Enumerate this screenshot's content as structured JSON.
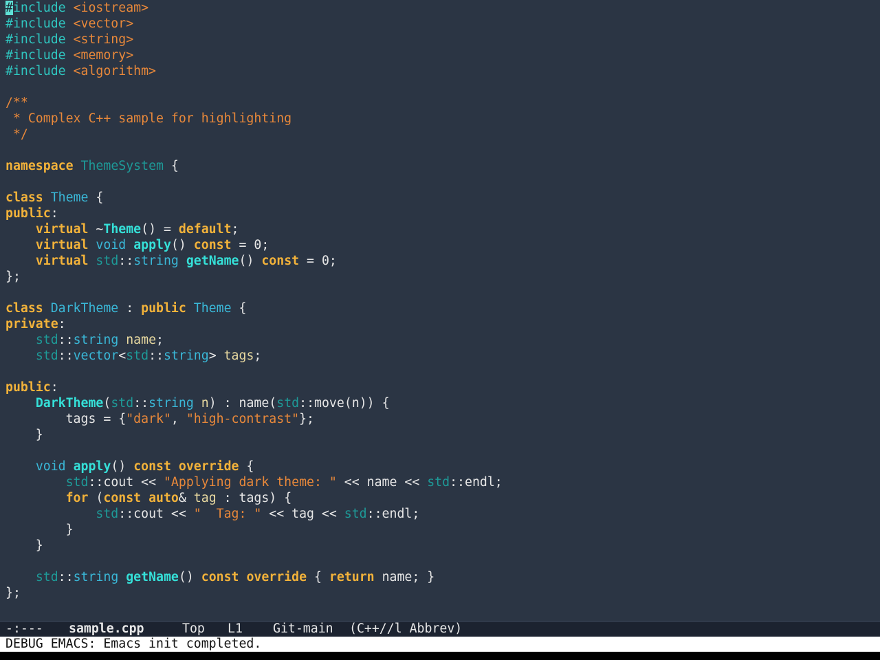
{
  "colors": {
    "background": "#2b3544",
    "text": "#e6e6e6",
    "preprocessor": "#2fc6c0",
    "include_path": "#e8883a",
    "comment": "#e8883a",
    "keyword": "#f2b23a",
    "type": "#3ab8d8",
    "function": "#35e0d8",
    "namespace_std": "#1e9a98",
    "string": "#e8883a",
    "variable": "#e8d9a0",
    "cursor": "#5fe0d6",
    "modeline_bg": "#1c2330",
    "echo_bg": "#ffffff"
  },
  "editor": {
    "cursor_char": "#",
    "lines": [
      [
        {
          "t": "include",
          "c": "preprocessor"
        },
        {
          "t": " ",
          "c": "text"
        },
        {
          "t": "<iostream>",
          "c": "include_path"
        }
      ],
      [
        {
          "t": "#include",
          "c": "preprocessor"
        },
        {
          "t": " ",
          "c": "text"
        },
        {
          "t": "<vector>",
          "c": "include_path"
        }
      ],
      [
        {
          "t": "#include",
          "c": "preprocessor"
        },
        {
          "t": " ",
          "c": "text"
        },
        {
          "t": "<string>",
          "c": "include_path"
        }
      ],
      [
        {
          "t": "#include",
          "c": "preprocessor"
        },
        {
          "t": " ",
          "c": "text"
        },
        {
          "t": "<memory>",
          "c": "include_path"
        }
      ],
      [
        {
          "t": "#include",
          "c": "preprocessor"
        },
        {
          "t": " ",
          "c": "text"
        },
        {
          "t": "<algorithm>",
          "c": "include_path"
        }
      ],
      [],
      [
        {
          "t": "/**",
          "c": "comment"
        }
      ],
      [
        {
          "t": " * Complex C++ sample for highlighting",
          "c": "comment"
        }
      ],
      [
        {
          "t": " */",
          "c": "comment"
        }
      ],
      [],
      [
        {
          "t": "namespace",
          "c": "keyword",
          "b": true
        },
        {
          "t": " ",
          "c": "text"
        },
        {
          "t": "ThemeSystem",
          "c": "namespace_std"
        },
        {
          "t": " {",
          "c": "text"
        }
      ],
      [],
      [
        {
          "t": "class",
          "c": "keyword",
          "b": true
        },
        {
          "t": " ",
          "c": "text"
        },
        {
          "t": "Theme",
          "c": "type"
        },
        {
          "t": " {",
          "c": "text"
        }
      ],
      [
        {
          "t": "public",
          "c": "keyword",
          "b": true
        },
        {
          "t": ":",
          "c": "text"
        }
      ],
      [
        {
          "t": "    ",
          "c": "text"
        },
        {
          "t": "virtual",
          "c": "keyword",
          "b": true
        },
        {
          "t": " ~",
          "c": "text"
        },
        {
          "t": "Theme",
          "c": "function",
          "b": true
        },
        {
          "t": "() = ",
          "c": "text"
        },
        {
          "t": "default",
          "c": "keyword",
          "b": true
        },
        {
          "t": ";",
          "c": "text"
        }
      ],
      [
        {
          "t": "    ",
          "c": "text"
        },
        {
          "t": "virtual",
          "c": "keyword",
          "b": true
        },
        {
          "t": " ",
          "c": "text"
        },
        {
          "t": "void",
          "c": "type"
        },
        {
          "t": " ",
          "c": "text"
        },
        {
          "t": "apply",
          "c": "function",
          "b": true
        },
        {
          "t": "() ",
          "c": "text"
        },
        {
          "t": "const",
          "c": "keyword",
          "b": true
        },
        {
          "t": " = 0;",
          "c": "text"
        }
      ],
      [
        {
          "t": "    ",
          "c": "text"
        },
        {
          "t": "virtual",
          "c": "keyword",
          "b": true
        },
        {
          "t": " ",
          "c": "text"
        },
        {
          "t": "std",
          "c": "namespace_std"
        },
        {
          "t": "::",
          "c": "text"
        },
        {
          "t": "string",
          "c": "type"
        },
        {
          "t": " ",
          "c": "text"
        },
        {
          "t": "getName",
          "c": "function",
          "b": true
        },
        {
          "t": "() ",
          "c": "text"
        },
        {
          "t": "const",
          "c": "keyword",
          "b": true
        },
        {
          "t": " = 0;",
          "c": "text"
        }
      ],
      [
        {
          "t": "};",
          "c": "text"
        }
      ],
      [],
      [
        {
          "t": "class",
          "c": "keyword",
          "b": true
        },
        {
          "t": " ",
          "c": "text"
        },
        {
          "t": "DarkTheme",
          "c": "type"
        },
        {
          "t": " : ",
          "c": "text"
        },
        {
          "t": "public",
          "c": "keyword",
          "b": true
        },
        {
          "t": " ",
          "c": "text"
        },
        {
          "t": "Theme",
          "c": "type"
        },
        {
          "t": " {",
          "c": "text"
        }
      ],
      [
        {
          "t": "private",
          "c": "keyword",
          "b": true
        },
        {
          "t": ":",
          "c": "text"
        }
      ],
      [
        {
          "t": "    ",
          "c": "text"
        },
        {
          "t": "std",
          "c": "namespace_std"
        },
        {
          "t": "::",
          "c": "text"
        },
        {
          "t": "string",
          "c": "type"
        },
        {
          "t": " ",
          "c": "text"
        },
        {
          "t": "name",
          "c": "variable"
        },
        {
          "t": ";",
          "c": "text"
        }
      ],
      [
        {
          "t": "    ",
          "c": "text"
        },
        {
          "t": "std",
          "c": "namespace_std"
        },
        {
          "t": "::",
          "c": "text"
        },
        {
          "t": "vector",
          "c": "type"
        },
        {
          "t": "<",
          "c": "text"
        },
        {
          "t": "std",
          "c": "namespace_std"
        },
        {
          "t": "::",
          "c": "text"
        },
        {
          "t": "string",
          "c": "type"
        },
        {
          "t": "> ",
          "c": "text"
        },
        {
          "t": "tags",
          "c": "variable"
        },
        {
          "t": ";",
          "c": "text"
        }
      ],
      [],
      [
        {
          "t": "public",
          "c": "keyword",
          "b": true
        },
        {
          "t": ":",
          "c": "text"
        }
      ],
      [
        {
          "t": "    ",
          "c": "text"
        },
        {
          "t": "DarkTheme",
          "c": "function",
          "b": true
        },
        {
          "t": "(",
          "c": "text"
        },
        {
          "t": "std",
          "c": "namespace_std"
        },
        {
          "t": "::",
          "c": "text"
        },
        {
          "t": "string",
          "c": "type"
        },
        {
          "t": " ",
          "c": "text"
        },
        {
          "t": "n",
          "c": "variable"
        },
        {
          "t": ") : name(",
          "c": "text"
        },
        {
          "t": "std",
          "c": "namespace_std"
        },
        {
          "t": "::move(n)) {",
          "c": "text"
        }
      ],
      [
        {
          "t": "        tags = {",
          "c": "text"
        },
        {
          "t": "\"dark\"",
          "c": "string"
        },
        {
          "t": ", ",
          "c": "text"
        },
        {
          "t": "\"high-contrast\"",
          "c": "string"
        },
        {
          "t": "};",
          "c": "text"
        }
      ],
      [
        {
          "t": "    }",
          "c": "text"
        }
      ],
      [],
      [
        {
          "t": "    ",
          "c": "text"
        },
        {
          "t": "void",
          "c": "type"
        },
        {
          "t": " ",
          "c": "text"
        },
        {
          "t": "apply",
          "c": "function",
          "b": true
        },
        {
          "t": "() ",
          "c": "text"
        },
        {
          "t": "const",
          "c": "keyword",
          "b": true
        },
        {
          "t": " ",
          "c": "text"
        },
        {
          "t": "override",
          "c": "keyword",
          "b": true
        },
        {
          "t": " {",
          "c": "text"
        }
      ],
      [
        {
          "t": "        ",
          "c": "text"
        },
        {
          "t": "std",
          "c": "namespace_std"
        },
        {
          "t": "::cout << ",
          "c": "text"
        },
        {
          "t": "\"Applying dark theme: \"",
          "c": "string"
        },
        {
          "t": " << name << ",
          "c": "text"
        },
        {
          "t": "std",
          "c": "namespace_std"
        },
        {
          "t": "::endl;",
          "c": "text"
        }
      ],
      [
        {
          "t": "        ",
          "c": "text"
        },
        {
          "t": "for",
          "c": "keyword",
          "b": true
        },
        {
          "t": " (",
          "c": "text"
        },
        {
          "t": "const",
          "c": "keyword",
          "b": true
        },
        {
          "t": " ",
          "c": "text"
        },
        {
          "t": "auto",
          "c": "keyword",
          "b": true
        },
        {
          "t": "& ",
          "c": "text"
        },
        {
          "t": "tag",
          "c": "variable"
        },
        {
          "t": " : tags) {",
          "c": "text"
        }
      ],
      [
        {
          "t": "            ",
          "c": "text"
        },
        {
          "t": "std",
          "c": "namespace_std"
        },
        {
          "t": "::cout << ",
          "c": "text"
        },
        {
          "t": "\"  Tag: \"",
          "c": "string"
        },
        {
          "t": " << tag << ",
          "c": "text"
        },
        {
          "t": "std",
          "c": "namespace_std"
        },
        {
          "t": "::endl;",
          "c": "text"
        }
      ],
      [
        {
          "t": "        }",
          "c": "text"
        }
      ],
      [
        {
          "t": "    }",
          "c": "text"
        }
      ],
      [],
      [
        {
          "t": "    ",
          "c": "text"
        },
        {
          "t": "std",
          "c": "namespace_std"
        },
        {
          "t": "::",
          "c": "text"
        },
        {
          "t": "string",
          "c": "type"
        },
        {
          "t": " ",
          "c": "text"
        },
        {
          "t": "getName",
          "c": "function",
          "b": true
        },
        {
          "t": "() ",
          "c": "text"
        },
        {
          "t": "const",
          "c": "keyword",
          "b": true
        },
        {
          "t": " ",
          "c": "text"
        },
        {
          "t": "override",
          "c": "keyword",
          "b": true
        },
        {
          "t": " { ",
          "c": "text"
        },
        {
          "t": "return",
          "c": "keyword",
          "b": true
        },
        {
          "t": " name; }",
          "c": "text"
        }
      ],
      [
        {
          "t": "};",
          "c": "text"
        }
      ]
    ]
  },
  "modeline": {
    "status": "-:---",
    "buffer_name": "sample.cpp",
    "position": "Top",
    "line": "L1",
    "vc": "Git-main",
    "modes": "(C++//l Abbrev)"
  },
  "echo_area": {
    "message": "DEBUG EMACS: Emacs init completed."
  }
}
